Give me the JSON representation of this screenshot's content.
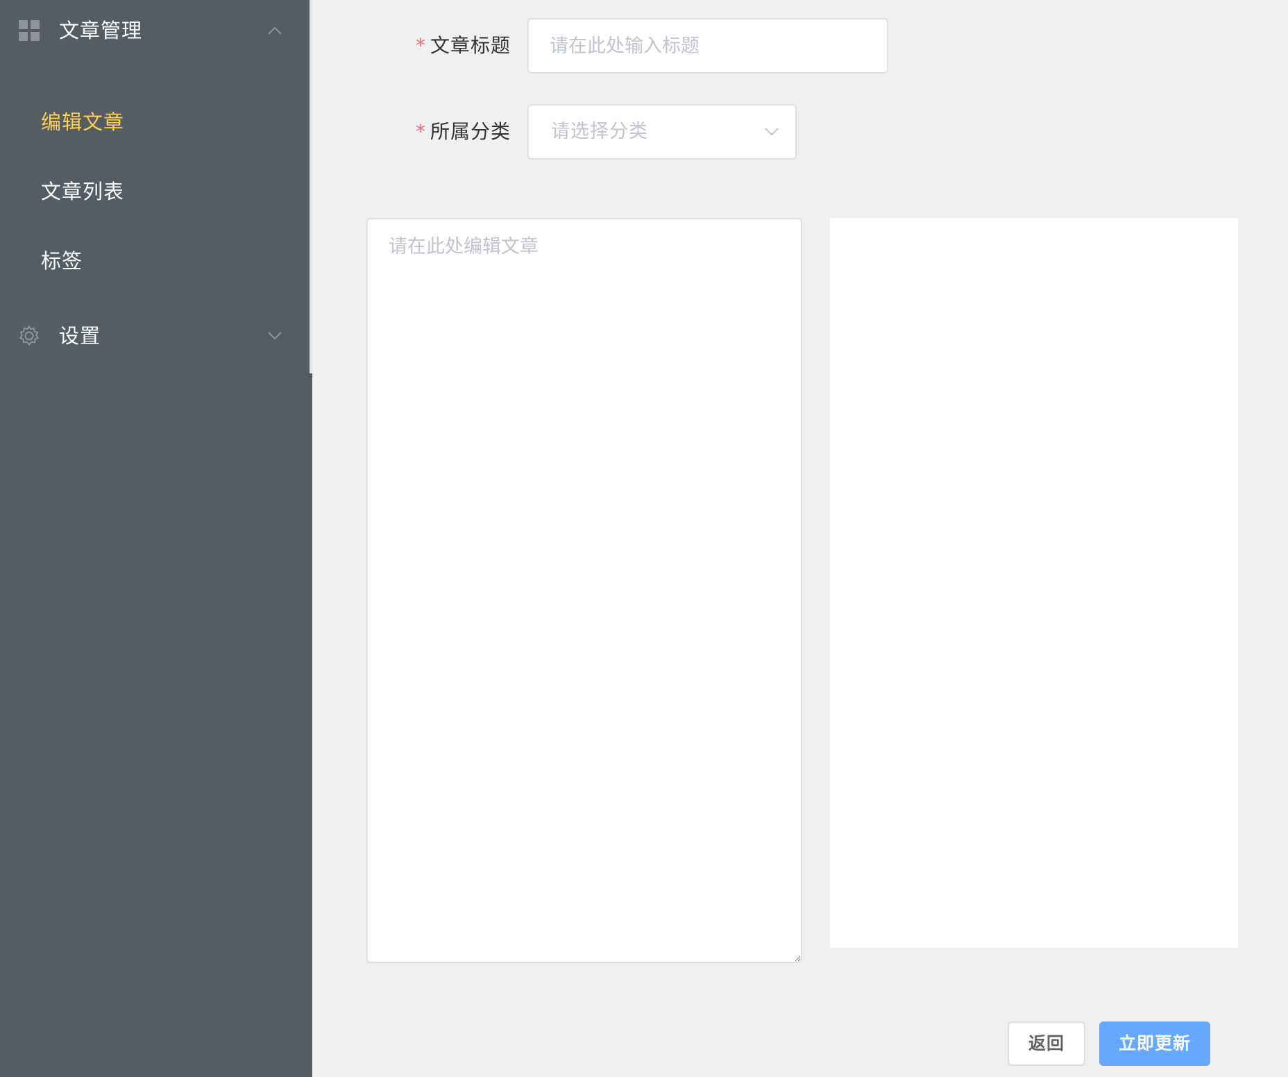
{
  "sidebar": {
    "groups": [
      {
        "icon": "grid-icon",
        "label": "文章管理",
        "expanded": true,
        "items": [
          {
            "label": "编辑文章",
            "active": true
          },
          {
            "label": "文章列表",
            "active": false
          },
          {
            "label": "标签",
            "active": false
          }
        ]
      },
      {
        "icon": "gear-icon",
        "label": "设置",
        "expanded": false
      }
    ],
    "active_color": "#ffd04b",
    "background_color": "#545c64"
  },
  "form": {
    "required_mark": "*",
    "title": {
      "label": "文章标题",
      "placeholder": "请在此处输入标题",
      "value": ""
    },
    "category": {
      "label": "所属分类",
      "placeholder": "请选择分类"
    },
    "content": {
      "placeholder": "请在此处编辑文章",
      "value": ""
    }
  },
  "actions": {
    "back_label": "返回",
    "update_label": "立即更新",
    "primary_color": "#66a8ff"
  }
}
